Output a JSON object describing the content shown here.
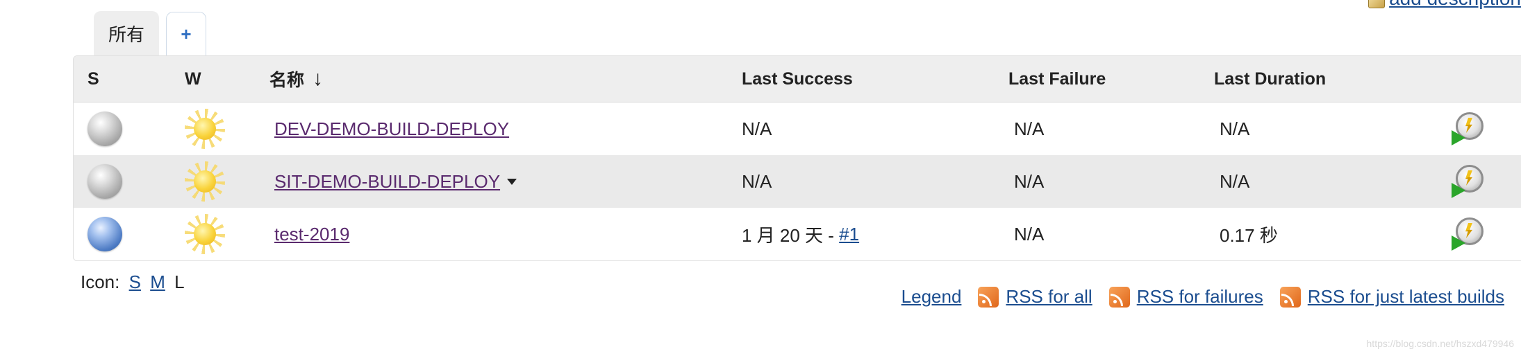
{
  "top_link": {
    "label": "add description"
  },
  "tabs": {
    "active_label": "所有",
    "add_label": "+"
  },
  "table": {
    "headers": {
      "s": "S",
      "w": "W",
      "name": "名称",
      "sort_arrow": "↓",
      "last_success": "Last Success",
      "last_failure": "Last Failure",
      "last_duration": "Last Duration"
    },
    "rows": [
      {
        "status": "grey",
        "weather": "sunny",
        "name": "DEV-DEMO-BUILD-DEPLOY",
        "last_success": "N/A",
        "last_failure": "N/A",
        "last_duration": "N/A"
      },
      {
        "status": "grey",
        "weather": "sunny",
        "name": "SIT-DEMO-BUILD-DEPLOY",
        "has_dropdown": true,
        "last_success": "N/A",
        "last_failure": "N/A",
        "last_duration": "N/A"
      },
      {
        "status": "blue",
        "weather": "sunny",
        "name": "test-2019",
        "last_success": "1 月 20 天 - ",
        "last_success_build": "#1",
        "last_failure": "N/A",
        "last_duration": "0.17 秒"
      }
    ]
  },
  "icon_size": {
    "label": "Icon:",
    "options": [
      "S",
      "M",
      "L"
    ],
    "current": "L"
  },
  "footer": {
    "legend": "Legend",
    "rss_all": "RSS for all",
    "rss_failures": "RSS for failures",
    "rss_latest": "RSS for just latest builds"
  },
  "watermark": "https://blog.csdn.net/hszxd479946",
  "colors": {
    "link": "#1b4d8f",
    "visited_link": "#5a2a6e",
    "header_bg": "#eeeeee",
    "alt_row_bg": "#eaeaea"
  }
}
